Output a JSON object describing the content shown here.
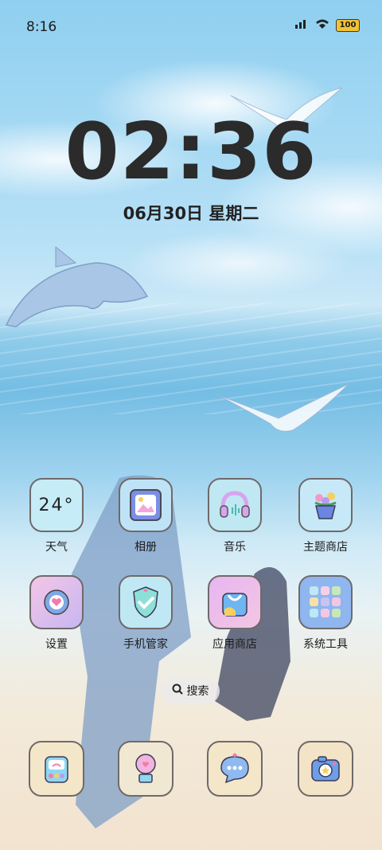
{
  "status_bar": {
    "time": "8:16",
    "battery": "100"
  },
  "lockclock": {
    "time": "02:36",
    "date": "06月30日 星期二"
  },
  "apps_row1": [
    {
      "label": "天气",
      "weather_value": "24°",
      "icon": "weather-icon"
    },
    {
      "label": "相册",
      "icon": "photo-album-icon"
    },
    {
      "label": "音乐",
      "icon": "headphones-icon"
    },
    {
      "label": "主题商店",
      "icon": "flower-pot-icon"
    }
  ],
  "apps_row2": [
    {
      "label": "设置",
      "icon": "gear-heart-icon"
    },
    {
      "label": "手机管家",
      "icon": "shield-icon"
    },
    {
      "label": "应用商店",
      "icon": "shopping-bag-icon"
    },
    {
      "label": "系统工具",
      "icon": "app-grid-icon"
    }
  ],
  "search": {
    "label": "搜索"
  },
  "dock": [
    {
      "icon": "phone-icon"
    },
    {
      "icon": "hot-air-balloon-icon"
    },
    {
      "icon": "chat-bubble-icon"
    },
    {
      "icon": "camera-icon"
    }
  ],
  "colors": {
    "tile_blue": "#bfe6f6",
    "tile_pink": "#f2c9ea",
    "tile_purple": "#c8b7f0",
    "accent_yellow": "#f1c232"
  }
}
